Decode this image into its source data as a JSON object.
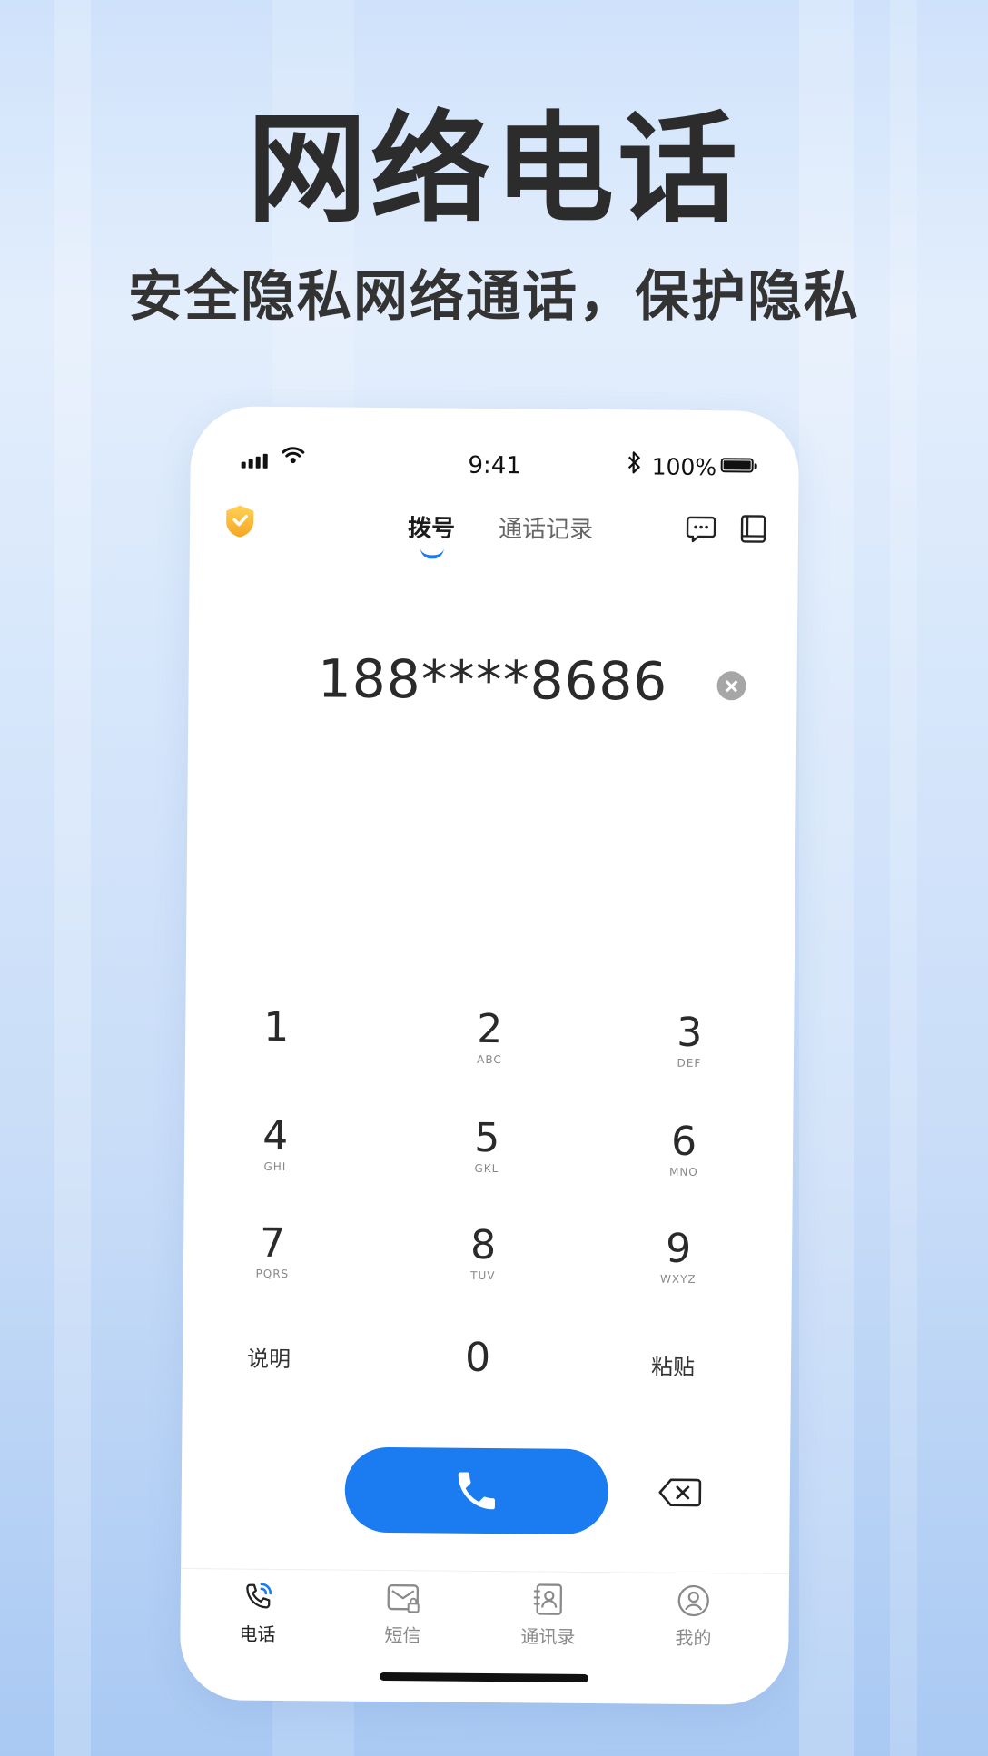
{
  "promo": {
    "headline": "网络电话",
    "subline": "安全隐私网络通话，保护隐私"
  },
  "status_bar": {
    "time": "9:41",
    "battery_text": "100%",
    "battery_level": 1.0,
    "icons": [
      "signal-icon",
      "wifi-icon",
      "bluetooth-icon",
      "battery-icon"
    ]
  },
  "header": {
    "logo_icon": "shield-icon",
    "tabs": [
      {
        "label": "拨号",
        "active": true
      },
      {
        "label": "通话记录",
        "active": false
      }
    ],
    "right_icons": [
      "chat-icon",
      "book-icon"
    ]
  },
  "dialer": {
    "number": "188****8686",
    "clear_icon": "clear-icon",
    "keys": [
      {
        "num": "1",
        "letters": ""
      },
      {
        "num": "2",
        "letters": "ABC"
      },
      {
        "num": "3",
        "letters": "DEF"
      },
      {
        "num": "4",
        "letters": "GHI"
      },
      {
        "num": "5",
        "letters": "GKL"
      },
      {
        "num": "6",
        "letters": "MNO"
      },
      {
        "num": "7",
        "letters": "PQRS"
      },
      {
        "num": "8",
        "letters": "TUV"
      },
      {
        "num": "9",
        "letters": "WXYZ"
      }
    ],
    "bottom_keys": {
      "left": "说明",
      "center": "0",
      "right": "粘贴"
    },
    "call_icon": "phone-icon",
    "backspace_icon": "backspace-icon"
  },
  "bottom_nav": [
    {
      "label": "电话",
      "icon": "phone-tab-icon",
      "active": true
    },
    {
      "label": "短信",
      "icon": "message-icon",
      "active": false
    },
    {
      "label": "通讯录",
      "icon": "contacts-icon",
      "active": false
    },
    {
      "label": "我的",
      "icon": "profile-icon",
      "active": false
    }
  ],
  "colors": {
    "accent": "#1a7cf0",
    "shield": "#f7b733",
    "text_dark": "#2a2a2a"
  }
}
